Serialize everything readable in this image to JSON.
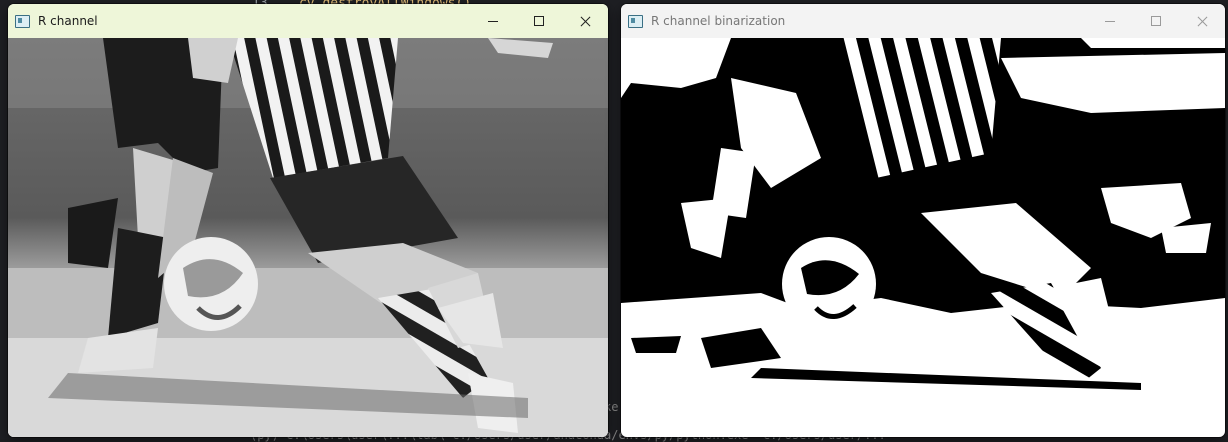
{
  "background": {
    "code_line": "cv.destroyAllWindows()",
    "line_number": "13",
    "terminal_line": "(py) C:\\Users\\user\\...\\lab\\ c:/Users/user/anaconda/envs/py/python.exe \"c:/Users/user/...\"",
    "frag_1": "s",
    "frag_2": "ke"
  },
  "windows": [
    {
      "title": "R channel",
      "active": true,
      "titlebar_color": "#eef6d9",
      "image_desc": "grayscale-football"
    },
    {
      "title": "R channel binarization",
      "active": false,
      "titlebar_color": "#f3f3f3",
      "image_desc": "binary-football"
    }
  ]
}
